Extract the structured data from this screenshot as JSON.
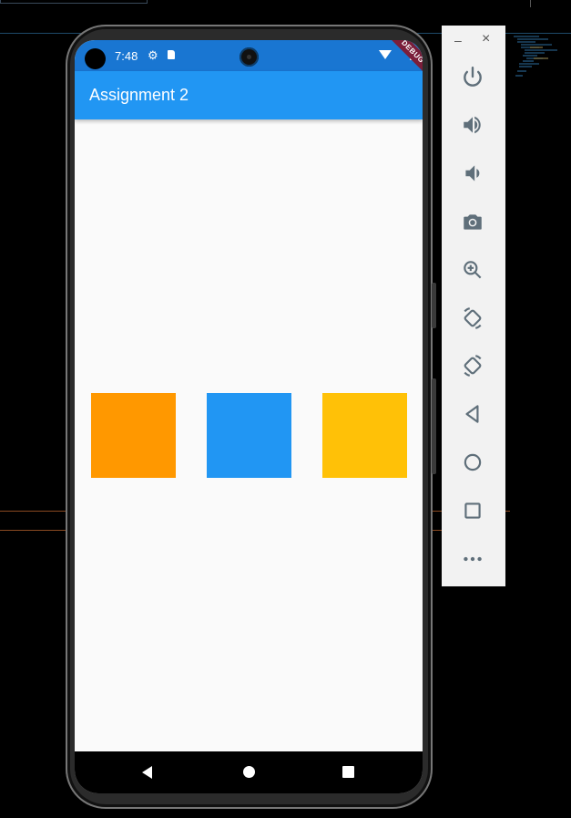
{
  "status_bar": {
    "time": "7:48",
    "debug_label": "DEBUG"
  },
  "app_bar": {
    "title": "Assignment 2"
  },
  "boxes": [
    {
      "name": "orange-box",
      "color": "#ff9800"
    },
    {
      "name": "blue-box",
      "color": "#2196f3"
    },
    {
      "name": "amber-box",
      "color": "#ffc107"
    }
  ],
  "emulator_toolbar": {
    "window_controls": {
      "minimize": "–",
      "close": "×"
    },
    "buttons": [
      "power-icon",
      "volume-up-icon",
      "volume-down-icon",
      "camera-icon",
      "zoom-icon",
      "rotate-left-icon",
      "rotate-right-icon",
      "back-icon",
      "home-icon",
      "overview-icon",
      "more-icon"
    ]
  },
  "colors": {
    "status_bar": "#1976d2",
    "app_bar": "#2196f3",
    "screen_bg": "#fafafa"
  }
}
